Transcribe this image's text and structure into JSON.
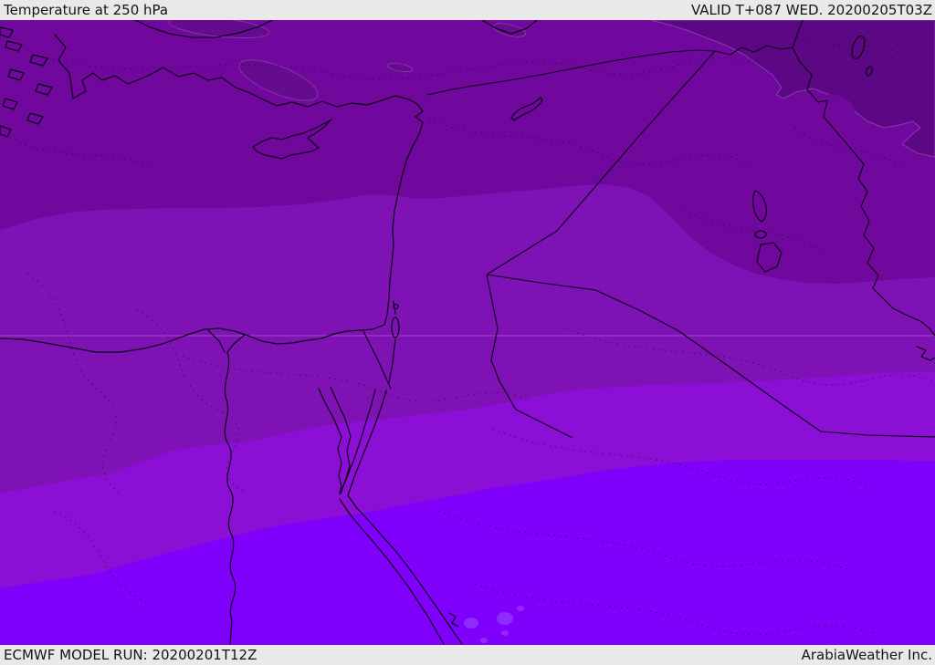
{
  "header": {
    "title": "Temperature at 250 hPa",
    "valid": "VALID T+087 WED. 20200205T03Z"
  },
  "footer": {
    "model_run": "ECMWF MODEL RUN: 20200201T12Z",
    "brand": "ArabiaWeather Inc."
  },
  "map": {
    "bands": {
      "a": {
        "tone": "darkest",
        "color": "#5C0884"
      },
      "a2": {
        "tone": "dark patch",
        "color": "#650B8E"
      },
      "b": {
        "tone": "dark",
        "color": "#70089E"
      },
      "c": {
        "tone": "medium",
        "color": "#7E12B4"
      },
      "d": {
        "tone": "bright",
        "color": "#8B0FD4"
      },
      "e": {
        "tone": "brightest",
        "color": "#7F00FB"
      },
      "e2": {
        "tone": "light spots",
        "color": "#8E2BFD"
      }
    },
    "ui": {
      "bar_bg": "#E9E9E9",
      "text_color": "#141414",
      "line_color": "#0A0512",
      "graticule_color": "rgba(255,205,255,0.28)"
    }
  }
}
